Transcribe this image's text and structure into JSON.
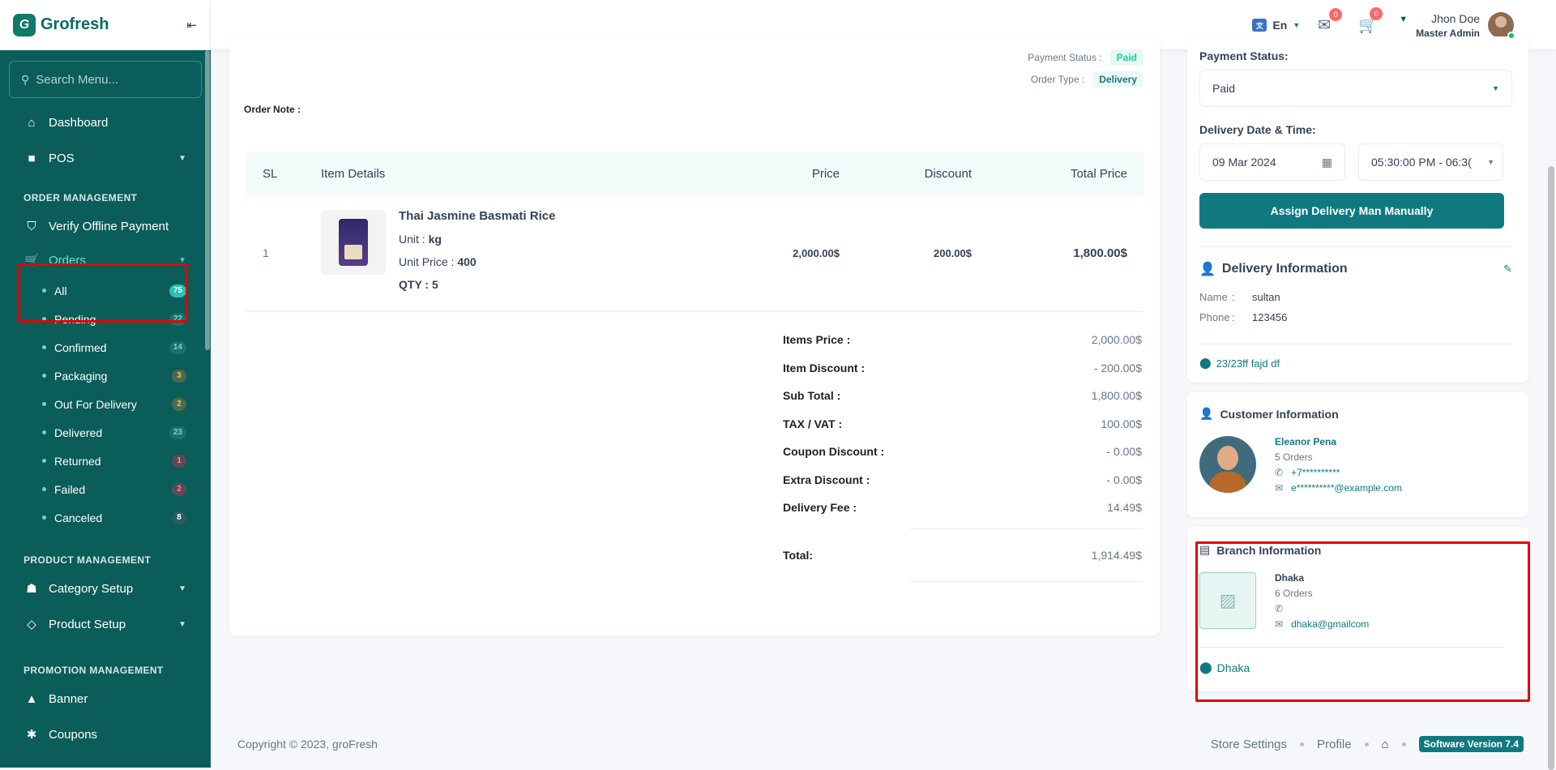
{
  "brand": {
    "name": "Grofresh",
    "logo_letter": "G",
    "collapse_icon": "collapse-icon",
    "color": "#0a5d59"
  },
  "sidebar": {
    "search_placeholder": "Search Menu...",
    "dashboard": "Dashboard",
    "pos": "POS",
    "order_management": "ORDER MANAGEMENT",
    "verify_offline": "Verify Offline Payment",
    "orders": "Orders",
    "order_subitems": [
      {
        "label": "All",
        "count": "75",
        "color": "#2bc0b7",
        "text": "#fff"
      },
      {
        "label": "Pending",
        "count": "22",
        "color": "#1b706c",
        "text": "#6ad9cf"
      },
      {
        "label": "Confirmed",
        "count": "14",
        "color": "#1b706c",
        "text": "#6ad9cf"
      },
      {
        "label": "Packaging",
        "count": "3",
        "color": "#4b6b50",
        "text": "#f7c04a"
      },
      {
        "label": "Out For Delivery",
        "count": "2",
        "color": "#4b6b50",
        "text": "#f7c04a"
      },
      {
        "label": "Delivered",
        "count": "23",
        "color": "#1b706c",
        "text": "#6ad9cf"
      },
      {
        "label": "Returned",
        "count": "1",
        "color": "#5b4a55",
        "text": "#ff8a8a"
      },
      {
        "label": "Failed",
        "count": "2",
        "color": "#5b4a55",
        "text": "#ff8a8a"
      },
      {
        "label": "Canceled",
        "count": "8",
        "color": "#2a5c63",
        "text": "#ffffff"
      }
    ],
    "product_management": "PRODUCT MANAGEMENT",
    "category_setup": "Category Setup",
    "product_setup": "Product Setup",
    "promotion_management": "PROMOTION MANAGEMENT",
    "banner": "Banner",
    "coupons": "Coupons"
  },
  "topbar": {
    "lang": "En",
    "message_count": "0",
    "cart_count": "0",
    "user_name": "Jhon Doe",
    "user_role": "Master Admin"
  },
  "order": {
    "payment_status_label": "Payment Status :",
    "payment_status": "Paid",
    "order_type_label": "Order Type :",
    "order_type": "Delivery",
    "order_note_label": "Order Note :",
    "table_headers": {
      "sl": "SL",
      "item": "Item Details",
      "price": "Price",
      "discount": "Discount",
      "total": "Total Price"
    },
    "item": {
      "sl": "1",
      "name": "Thai Jasmine Basmati Rice",
      "unit_label": "Unit :",
      "unit": "kg",
      "unit_price_label": "Unit Price :",
      "unit_price": "400",
      "qty_label": "QTY :",
      "qty": "5",
      "price": "2,000.00$",
      "discount": "200.00$",
      "total": "1,800.00$"
    },
    "summary": [
      {
        "label": "Items Price :",
        "value": "2,000.00$"
      },
      {
        "label": "Item Discount :",
        "value": "- 200.00$"
      },
      {
        "label": "Sub Total :",
        "value": "1,800.00$"
      },
      {
        "label": "TAX / VAT :",
        "value": "100.00$"
      },
      {
        "label": "Coupon Discount :",
        "value": "- 0.00$"
      },
      {
        "label": "Extra Discount :",
        "value": "- 0.00$"
      },
      {
        "label": "Delivery Fee :",
        "value": "14.49$"
      }
    ],
    "total_label": "Total:",
    "total_value": "1,914.49$"
  },
  "right": {
    "payment_status_label": "Payment Status:",
    "payment_status_value": "Paid",
    "delivery_dt_label": "Delivery Date & Time:",
    "delivery_date": "09 Mar 2024",
    "delivery_time": "05:30:00 PM - 06:3(",
    "assign_btn": "Assign Delivery Man Manually",
    "delivery_info_title": "Delivery Information",
    "name_label": "Name",
    "name_value": "sultan",
    "phone_label": "Phone",
    "phone_value": "123456",
    "address": "23/23ff fajd df",
    "customer_title": "Customer Information",
    "customer_name": "Eleanor Pena",
    "customer_orders": "5 Orders",
    "customer_phone": "+7**********",
    "customer_email": "e**********@example.com",
    "branch_title": "Branch Information",
    "branch_name": "Dhaka",
    "branch_orders": "6 Orders",
    "branch_phone": "",
    "branch_email": "dhaka@gmailcom",
    "branch_location": "Dhaka"
  },
  "footer": {
    "copyright": "Copyright © 2023, groFresh",
    "store_settings": "Store Settings",
    "profile": "Profile",
    "version": "Software Version 7.4"
  }
}
